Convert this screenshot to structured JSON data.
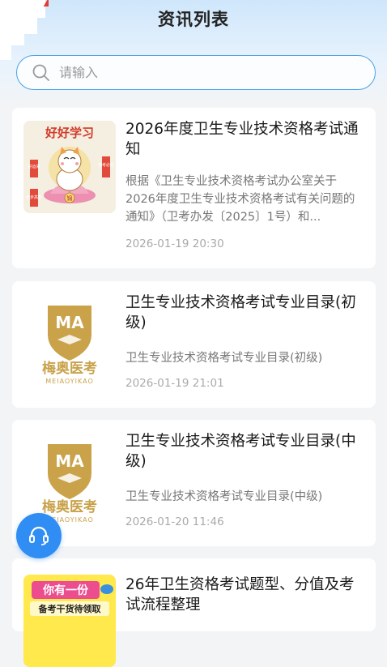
{
  "header": {
    "title": "资讯列表"
  },
  "search": {
    "placeholder": "请输入"
  },
  "articles": [
    {
      "title": "2026年度卫生专业技术资格考试通知",
      "summary": "根据《卫生专业技术资格考试办公室关于2026年度卫生专业技术资格考试有关问题的通知》（卫考办发〔2025〕1号）和...",
      "time": "2026-01-19 20:30",
      "thumb": {
        "text_top": "好好学习",
        "badge": "锦",
        "side_left": "好运来",
        "side_right": "逢考必过",
        "side_bottom": "步步高升"
      }
    },
    {
      "title": "卫生专业技术资格考试专业目录(初级)",
      "summary": "卫生专业技术资格考试专业目录(初级)",
      "time": "2026-01-19 21:01",
      "thumb": {
        "mark": "MA",
        "brand_cn": "梅奥医考",
        "brand_en": "MEIAOYIKAO"
      }
    },
    {
      "title": "卫生专业技术资格考试专业目录(中级)",
      "summary": "卫生专业技术资格考试专业目录(中级)",
      "time": "2026-01-20 11:46",
      "thumb": {
        "mark": "MA",
        "brand_cn": "梅奥医考",
        "brand_en": "MEIAOYIKAO"
      }
    },
    {
      "title": "26年卫生资格考试题型、分值及考试流程整理",
      "thumb": {
        "line1": "你有一份",
        "line2": "备考干货待领取"
      }
    }
  ],
  "colors": {
    "accent": "#2f8df3",
    "search_border": "#4aa3e8",
    "brand_gold": "#c9a24a"
  },
  "icons": {
    "search": "search-icon",
    "customer_service": "headset-icon"
  }
}
